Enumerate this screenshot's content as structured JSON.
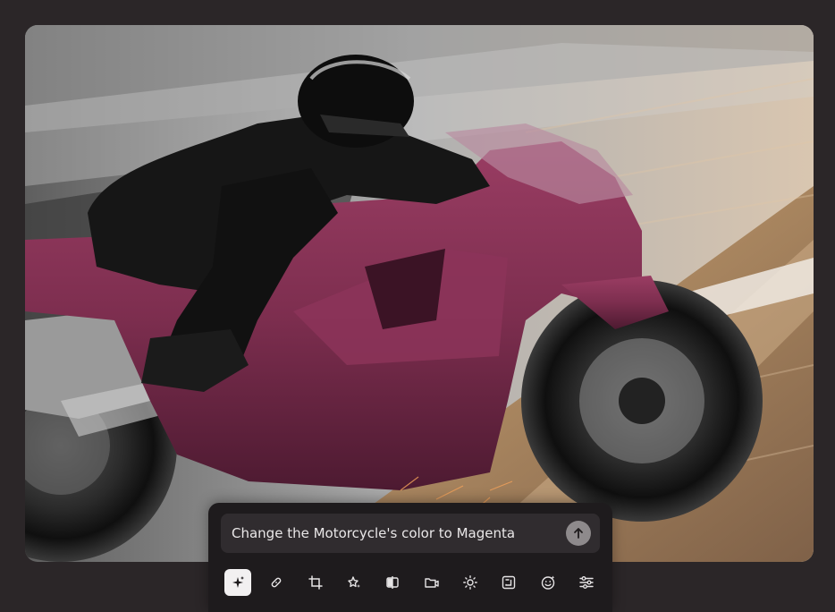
{
  "prompt": {
    "text": "Change the Motorcycle's color to Magenta",
    "send_icon": "arrow-up-icon"
  },
  "toolbar": {
    "tools": [
      {
        "icon": "sparkles-ai-icon",
        "active": true
      },
      {
        "icon": "bandage-heal-icon",
        "active": false
      },
      {
        "icon": "crop-icon",
        "active": false
      },
      {
        "icon": "magic-star-icon",
        "active": false
      },
      {
        "icon": "compare-split-icon",
        "active": false
      },
      {
        "icon": "folder-video-icon",
        "active": false
      },
      {
        "icon": "brightness-sun-icon",
        "active": false
      },
      {
        "icon": "resize-frame-icon",
        "active": false
      },
      {
        "icon": "face-smile-icon",
        "active": false
      },
      {
        "icon": "sliders-adjust-icon",
        "active": false
      }
    ]
  },
  "colors": {
    "background": "#2b2628",
    "panel": "#1e1b1d",
    "input": "#302c2f",
    "motorcycle": "#7d2e4f"
  },
  "image": {
    "subject": "motorcycle-racer-photo"
  }
}
